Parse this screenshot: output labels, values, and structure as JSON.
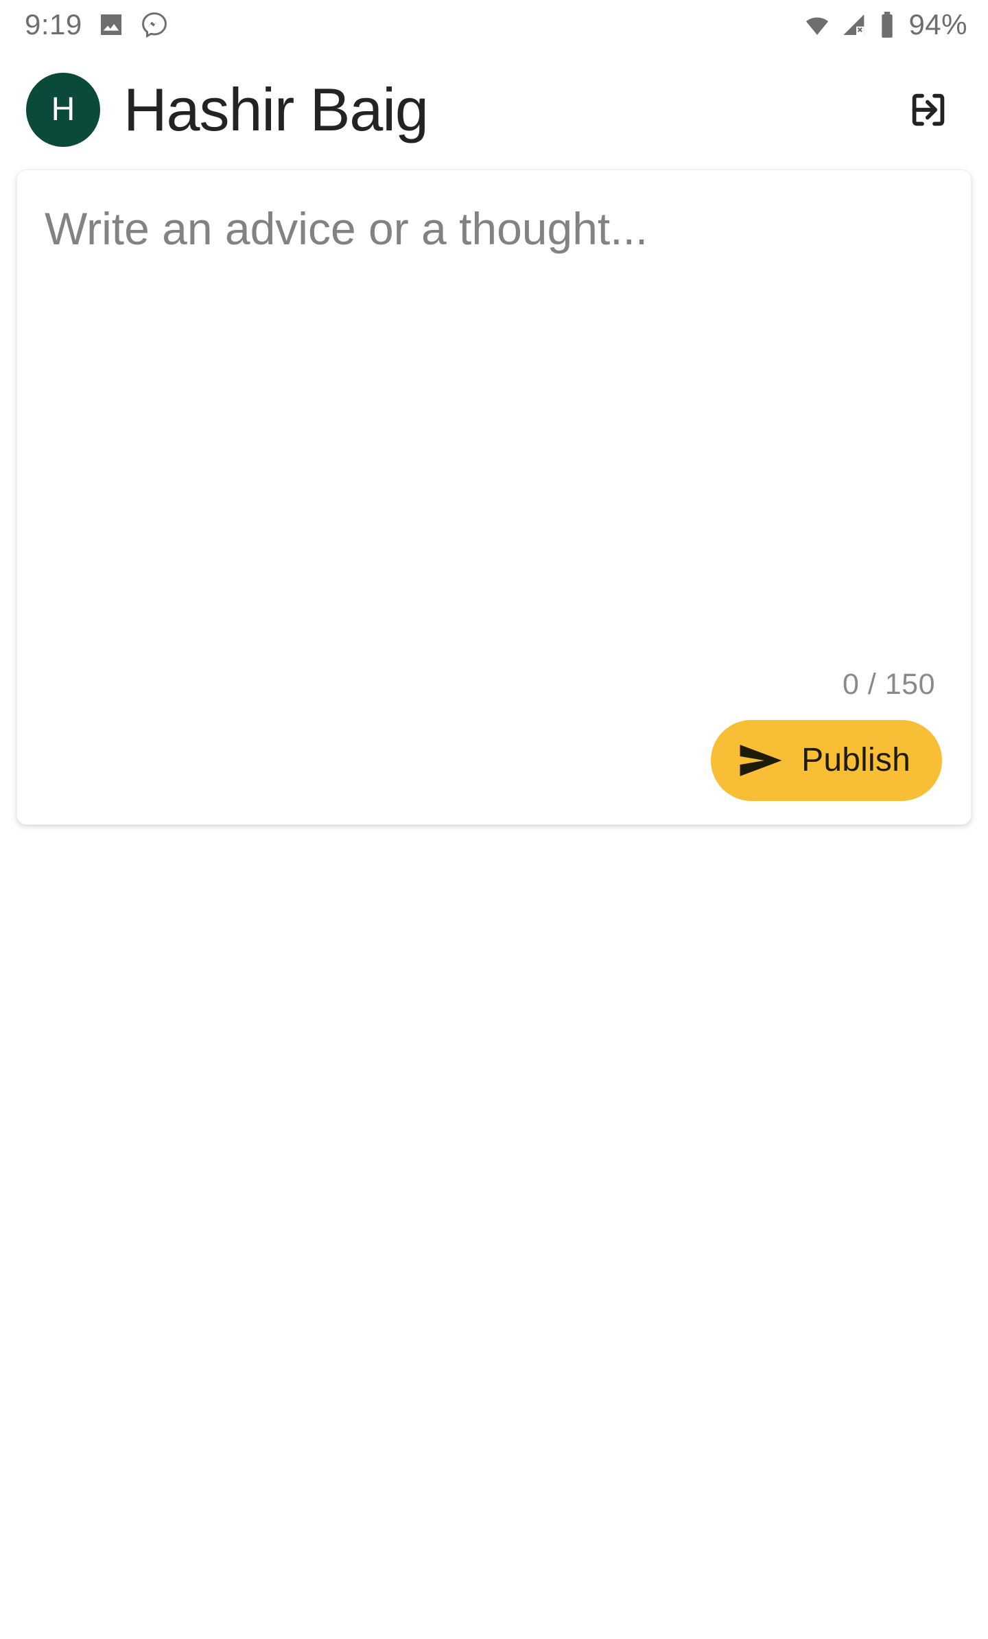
{
  "status_bar": {
    "time": "9:19",
    "battery_percent": "94%",
    "left_icons": [
      "gallery-icon",
      "messenger-icon"
    ],
    "right_icons": [
      "wifi-icon",
      "cellular-no-service-icon",
      "battery-icon"
    ],
    "icon_color": "#6e6e6e"
  },
  "header": {
    "avatar_initial": "H",
    "avatar_color": "#0b4a3a",
    "username": "Hashir Baig",
    "username_color": "#232323",
    "logout_icon": "logout-icon"
  },
  "composer": {
    "placeholder": "Write an advice or a thought...",
    "value": "",
    "char_count": "0 / 150",
    "current_chars": 0,
    "max_chars": 150,
    "publish_label": "Publish",
    "publish_icon": "send-icon",
    "publish_color": "#f8be36",
    "publish_text_color": "#1f1b09"
  }
}
